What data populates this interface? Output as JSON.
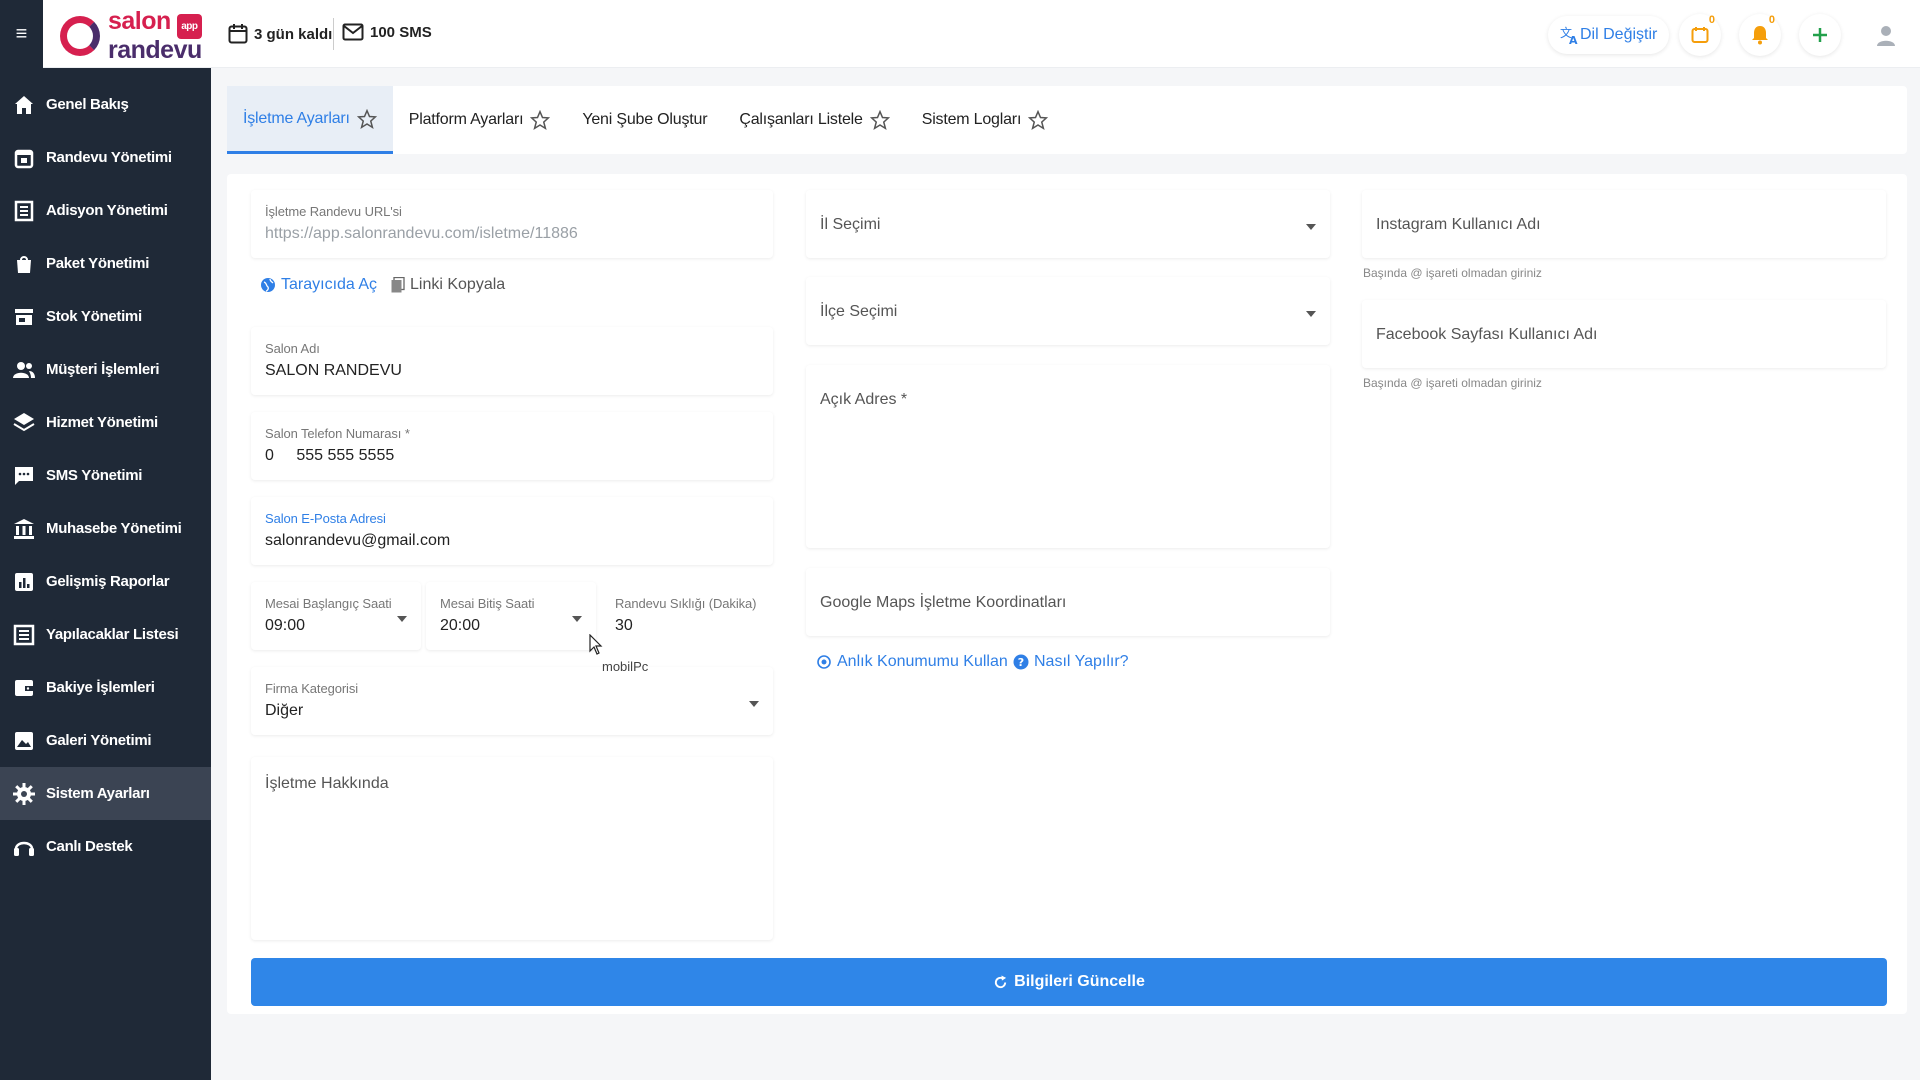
{
  "header": {
    "days_left": "3 gün kaldı",
    "sms_count": "100 SMS",
    "lang_label": "Dil Değiştir",
    "calendar_badge": "0",
    "bell_badge": "0"
  },
  "logo": {
    "line1": "salon",
    "badge": "app",
    "line2": "randevu"
  },
  "sidebar": {
    "items": [
      {
        "label": "Genel Bakış"
      },
      {
        "label": "Randevu Yönetimi"
      },
      {
        "label": "Adisyon Yönetimi"
      },
      {
        "label": "Paket Yönetimi"
      },
      {
        "label": "Stok Yönetimi"
      },
      {
        "label": "Müşteri İşlemleri"
      },
      {
        "label": "Hizmet Yönetimi"
      },
      {
        "label": "SMS Yönetimi"
      },
      {
        "label": "Muhasebe Yönetimi"
      },
      {
        "label": "Gelişmiş Raporlar"
      },
      {
        "label": "Yapılacaklar Listesi"
      },
      {
        "label": "Bakiye İşlemleri"
      },
      {
        "label": "Galeri Yönetimi"
      },
      {
        "label": "Sistem Ayarları"
      },
      {
        "label": "Canlı Destek"
      }
    ]
  },
  "tabs": [
    {
      "label": "İşletme Ayarları"
    },
    {
      "label": "Platform Ayarları"
    },
    {
      "label": "Yeni Şube Oluştur"
    },
    {
      "label": "Çalışanları Listele"
    },
    {
      "label": "Sistem Logları"
    }
  ],
  "form": {
    "url": {
      "label": "İşletme Randevu URL'si",
      "value": "https://app.salonrandevu.com/isletme/11886"
    },
    "open_browser": "Tarayıcıda Aç",
    "copy_link": "Linki Kopyala",
    "salon_name": {
      "label": "Salon Adı",
      "value": "SALON RANDEVU"
    },
    "phone": {
      "label": "Salon Telefon Numarası *",
      "prefix": "0",
      "value": "555 555 5555"
    },
    "email": {
      "label": "Salon E-Posta Adresi",
      "value": "salonrandevu@gmail.com"
    },
    "start_time": {
      "label": "Mesai Başlangıç Saati",
      "value": "09:00"
    },
    "end_time": {
      "label": "Mesai Bitiş Saati",
      "value": "20:00"
    },
    "frequency": {
      "label": "Randevu Sıklığı (Dakika)",
      "value": "30"
    },
    "category": {
      "label": "Firma Kategorisi",
      "value": "Diğer"
    },
    "about": {
      "placeholder": "İşletme Hakkında"
    },
    "city": {
      "placeholder": "İl Seçimi"
    },
    "district": {
      "placeholder": "İlçe Seçimi"
    },
    "address": {
      "placeholder": "Açık Adres *"
    },
    "maps": {
      "placeholder": "Google Maps İşletme Koordinatları"
    },
    "use_location": "Anlık Konumumu Kullan",
    "how_to": "Nasıl Yapılır?",
    "instagram": {
      "placeholder": "Instagram Kullanıcı Adı",
      "hint": "Başında @ işareti olmadan giriniz"
    },
    "facebook": {
      "placeholder": "Facebook Sayfası Kullanıcı Adı",
      "hint": "Başında @ işareti olmadan giriniz"
    },
    "submit": "Bilgileri Güncelle"
  },
  "tooltip": "mobilPc",
  "colors": {
    "sidebar": "#1f2937",
    "accent": "#2f86e8",
    "brand_red": "#d6204f",
    "brand_purple": "#4a2d6b"
  }
}
